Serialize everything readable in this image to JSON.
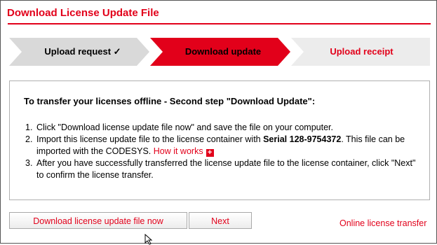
{
  "title": "Download License Update File",
  "steps": [
    {
      "label": "Upload request ✓",
      "state": "done"
    },
    {
      "label": "Download update",
      "state": "active"
    },
    {
      "label": "Upload receipt",
      "state": "pending"
    }
  ],
  "instructions": {
    "heading": "To transfer your licenses offline - Second step \"Download Update\":",
    "item1": {
      "num": "1.",
      "text": "Click \"Download license update file now\" and save the file on your computer."
    },
    "item2": {
      "num": "2.",
      "before": "Import this license update file to the license container with ",
      "serial": "Serial 128-9754372",
      "after": ". This file can be imported with the CODESYS. ",
      "link": "How it works",
      "plus_icon": "plus-icon"
    },
    "item3": {
      "num": "3.",
      "text": "After you have successfully transferred the license update file to the license container, click \"Next\" to confirm the license transfer."
    }
  },
  "buttons": {
    "download": "Download license update file now",
    "next": "Next"
  },
  "online_link": "Online license transfer",
  "colors": {
    "accent": "#e2001a",
    "step_inactive": "#d9d9d9",
    "step_pending": "#ececec",
    "border": "#b0b0b0"
  }
}
